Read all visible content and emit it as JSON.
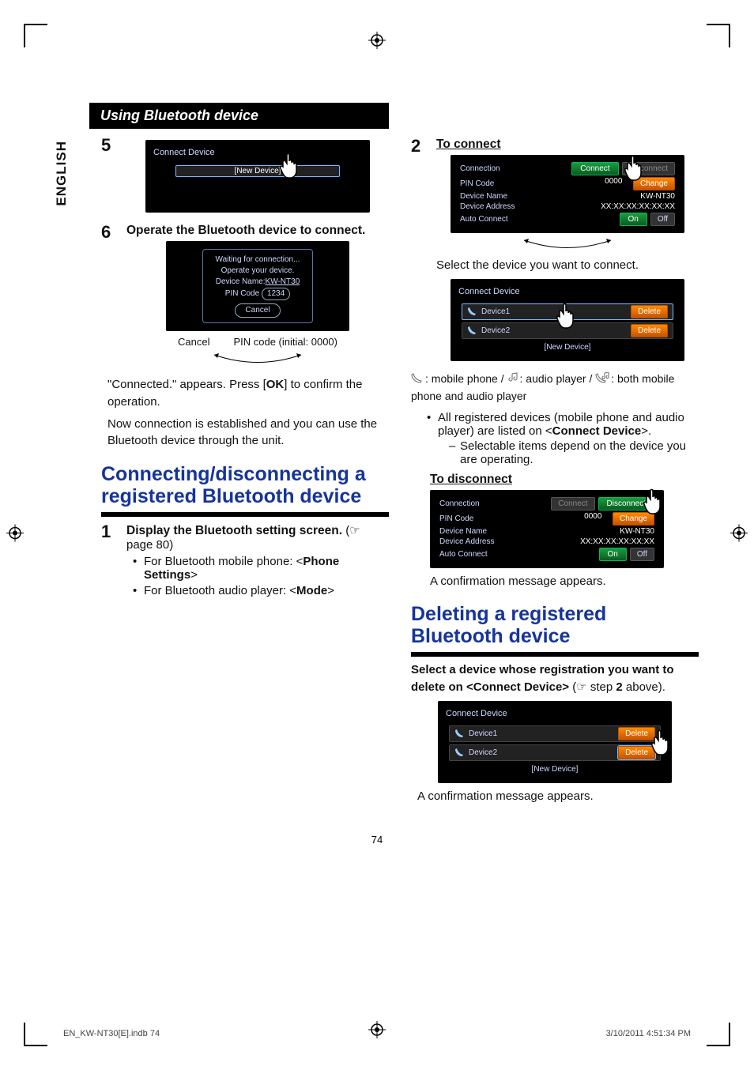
{
  "lang_tab": "ENGLISH",
  "section_title": "Using Bluetooth device",
  "left": {
    "step5_num": "5",
    "screen5": {
      "header": "Connect Device",
      "new_device": "[New Device]"
    },
    "step6_num": "6",
    "step6_title": "Operate the Bluetooth device to connect.",
    "screen6": {
      "line1": "Waiting for connection...",
      "line2": "Operate your device.",
      "line3a": "Device Name:",
      "line3b": "KW-NT30",
      "line4a": "PIN Code",
      "line4b": "1234",
      "cancel": "Cancel"
    },
    "anno_cancel": "Cancel",
    "anno_pin": "PIN code (initial: 0000)",
    "para_connected": "\"Connected.\" appears. Press [OK] to confirm the operation.",
    "para_now": "Now connection is established and you can use the Bluetooth device through the unit.",
    "h2_connect": "Connecting/disconnecting a registered Bluetooth device",
    "step1_num": "1",
    "step1_title": "Display the Bluetooth setting screen.",
    "step1_ref_pointer": "(☞",
    "step1_ref": "page 80)",
    "b1_pre": "For Bluetooth mobile phone: <",
    "b1_bold": "Phone Settings",
    "b1_post": ">",
    "b2_pre": "For Bluetooth audio player: <",
    "b2_bold": "Mode",
    "b2_post": ">"
  },
  "right": {
    "step2_num": "2",
    "to_connect": "To connect",
    "screen_conn": {
      "rows": [
        {
          "k": "Connection",
          "btn1": "Connect",
          "btn2": "Disconnect",
          "btn2grey": true
        },
        {
          "k": "PIN Code",
          "v": "0000",
          "btn": "Change"
        },
        {
          "k": "Device Name",
          "v": "KW-NT30"
        },
        {
          "k": "Device Address",
          "v": "XX:XX:XX:XX:XX:XX"
        },
        {
          "k": "Auto Connect",
          "btn1": "On",
          "btn2": "Off",
          "btn2plain": true
        }
      ]
    },
    "select_dev": "Select the device you want to connect.",
    "screen_list": {
      "header": "Connect Device",
      "rows": [
        {
          "name": "Device1",
          "del": "Delete",
          "sel": true
        },
        {
          "name": "Device2",
          "del": "Delete"
        }
      ],
      "new_device": "[New Device]"
    },
    "legend_phone": ": mobile phone / ",
    "legend_audio": ": audio player / ",
    "legend_both": ": both mobile phone and audio player",
    "bullet_all_pre": "All registered devices (mobile phone and audio player) are listed on <",
    "bullet_all_bold": "Connect Device",
    "bullet_all_post": ">.",
    "sub_sel": "Selectable items depend on the device you are operating.",
    "to_disconnect": "To disconnect",
    "screen_disc": {
      "rows": [
        {
          "k": "Connection",
          "btn1": "Connect",
          "btn1grey": true,
          "btn2": "Disconnect"
        },
        {
          "k": "PIN Code",
          "v": "0000",
          "btn": "Change"
        },
        {
          "k": "Device Name",
          "v": "KW-NT30"
        },
        {
          "k": "Device Address",
          "v": "XX:XX:XX:XX:XX:XX"
        },
        {
          "k": "Auto Connect",
          "btn1": "On",
          "btn2": "Off",
          "btn2plain": true
        }
      ]
    },
    "confirm": "A confirmation message appears.",
    "h2_delete": "Deleting a registered Bluetooth device",
    "del_instr_pre": "Select a device whose registration you want to delete on <Connect Device>",
    "del_instr_ref": " (☞ step ",
    "del_instr_step": "2",
    "del_instr_post": " above).",
    "screen_del": {
      "header": "Connect Device",
      "rows": [
        {
          "name": "Device1",
          "del": "Delete"
        },
        {
          "name": "Device2",
          "del": "Delete",
          "selDel": true
        }
      ],
      "new_device": "[New Device]"
    },
    "confirm2": "A confirmation message appears."
  },
  "page_num": "74",
  "footer_left": "EN_KW-NT30[E].indb   74",
  "footer_right": "3/10/2011   4:51:34 PM"
}
